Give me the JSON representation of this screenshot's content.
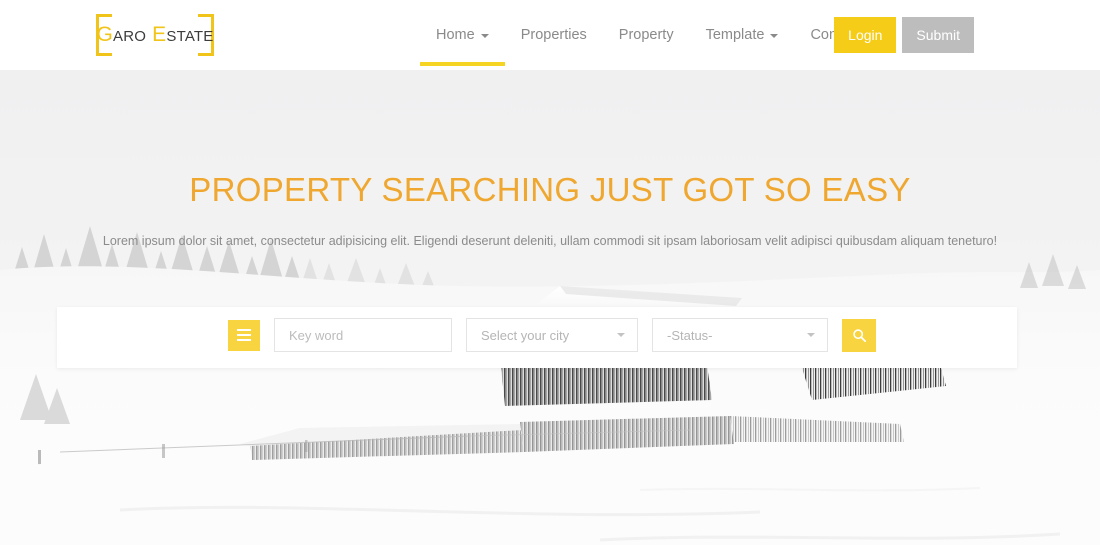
{
  "header": {
    "logo": {
      "part1_cap": "G",
      "part1_rest": "ARO",
      "part2_cap": "E",
      "part2_rest": "STATE",
      "full_text": "GARO ESTATE"
    },
    "nav": [
      {
        "label": "Home",
        "has_caret": true,
        "active": true
      },
      {
        "label": "Properties",
        "has_caret": false,
        "active": false
      },
      {
        "label": "Property",
        "has_caret": false,
        "active": false
      },
      {
        "label": "Template",
        "has_caret": true,
        "active": false
      },
      {
        "label": "Contact",
        "has_caret": false,
        "active": false
      }
    ],
    "buttons": {
      "login": "Login",
      "submit": "Submit"
    }
  },
  "hero": {
    "title": "PROPERTY SEARCHING JUST GOT SO EASY",
    "subtitle": "Lorem ipsum dolor sit amet, consectetur adipisicing elit. Eligendi deserunt deleniti, ullam commodi sit ipsam laboriosam velit adipisci quibusdam aliquam teneturo!"
  },
  "search": {
    "menu_icon": "hamburger-icon",
    "keyword_placeholder": "Key word",
    "keyword_value": "",
    "city_selected": "Select your city",
    "status_selected": "-Status-",
    "search_icon": "magnifier-icon"
  },
  "colors": {
    "accent_yellow": "#F5CC17",
    "search_yellow": "#F7D440",
    "logo_yellow": "#F0C419",
    "nav_underline": "#F5D423",
    "title_orange": "#EFA72F",
    "submit_gray": "#bdbdbd",
    "nav_text": "#8a8a8a",
    "body_text": "#8b8b8b",
    "panel_white": "#ffffff"
  }
}
